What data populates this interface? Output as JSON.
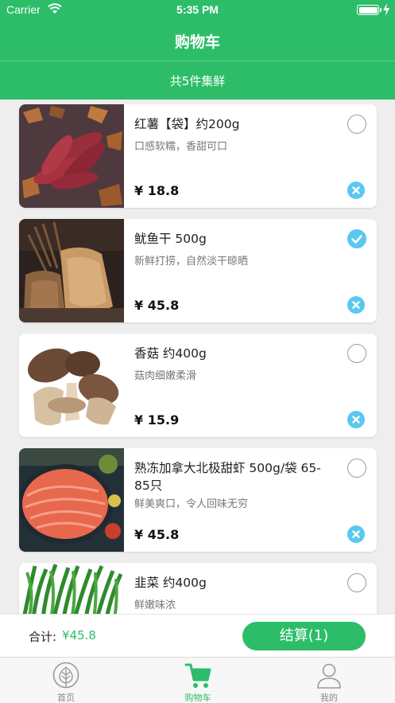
{
  "status_bar": {
    "carrier": "Carrier",
    "time": "5:35 PM"
  },
  "nav": {
    "title": "购物车"
  },
  "summary": "共5件集鲜",
  "currency": "¥",
  "items": [
    {
      "name": "红薯【袋】约200g",
      "desc": "口感软糯，香甜可口",
      "price": "18.8",
      "checked": false
    },
    {
      "name": "鱿鱼干 500g",
      "desc": "新鲜打捞，自然淡干晾晒",
      "price": "45.8",
      "checked": true
    },
    {
      "name": "香菇 约400g",
      "desc": "菇肉细嫩柔滑",
      "price": "15.9",
      "checked": false
    },
    {
      "name": "熟冻加拿大北极甜虾 500g/袋 65-85只",
      "desc": "鲜美爽口，令人回味无穷",
      "price": "45.8",
      "checked": false
    },
    {
      "name": "韭菜 约400g",
      "desc": "鲜嫩味浓",
      "price": "",
      "checked": false
    }
  ],
  "checkout": {
    "total_label": "合计:",
    "total_value": "¥45.8",
    "button_label": "结算(1)"
  },
  "tabs": [
    {
      "label": "首页",
      "icon": "leaf-icon",
      "active": false
    },
    {
      "label": "购物车",
      "icon": "cart-icon",
      "active": true
    },
    {
      "label": "我的",
      "icon": "person-icon",
      "active": false
    }
  ],
  "colors": {
    "brand": "#2dbd69",
    "check_accent": "#5ac8f0"
  }
}
